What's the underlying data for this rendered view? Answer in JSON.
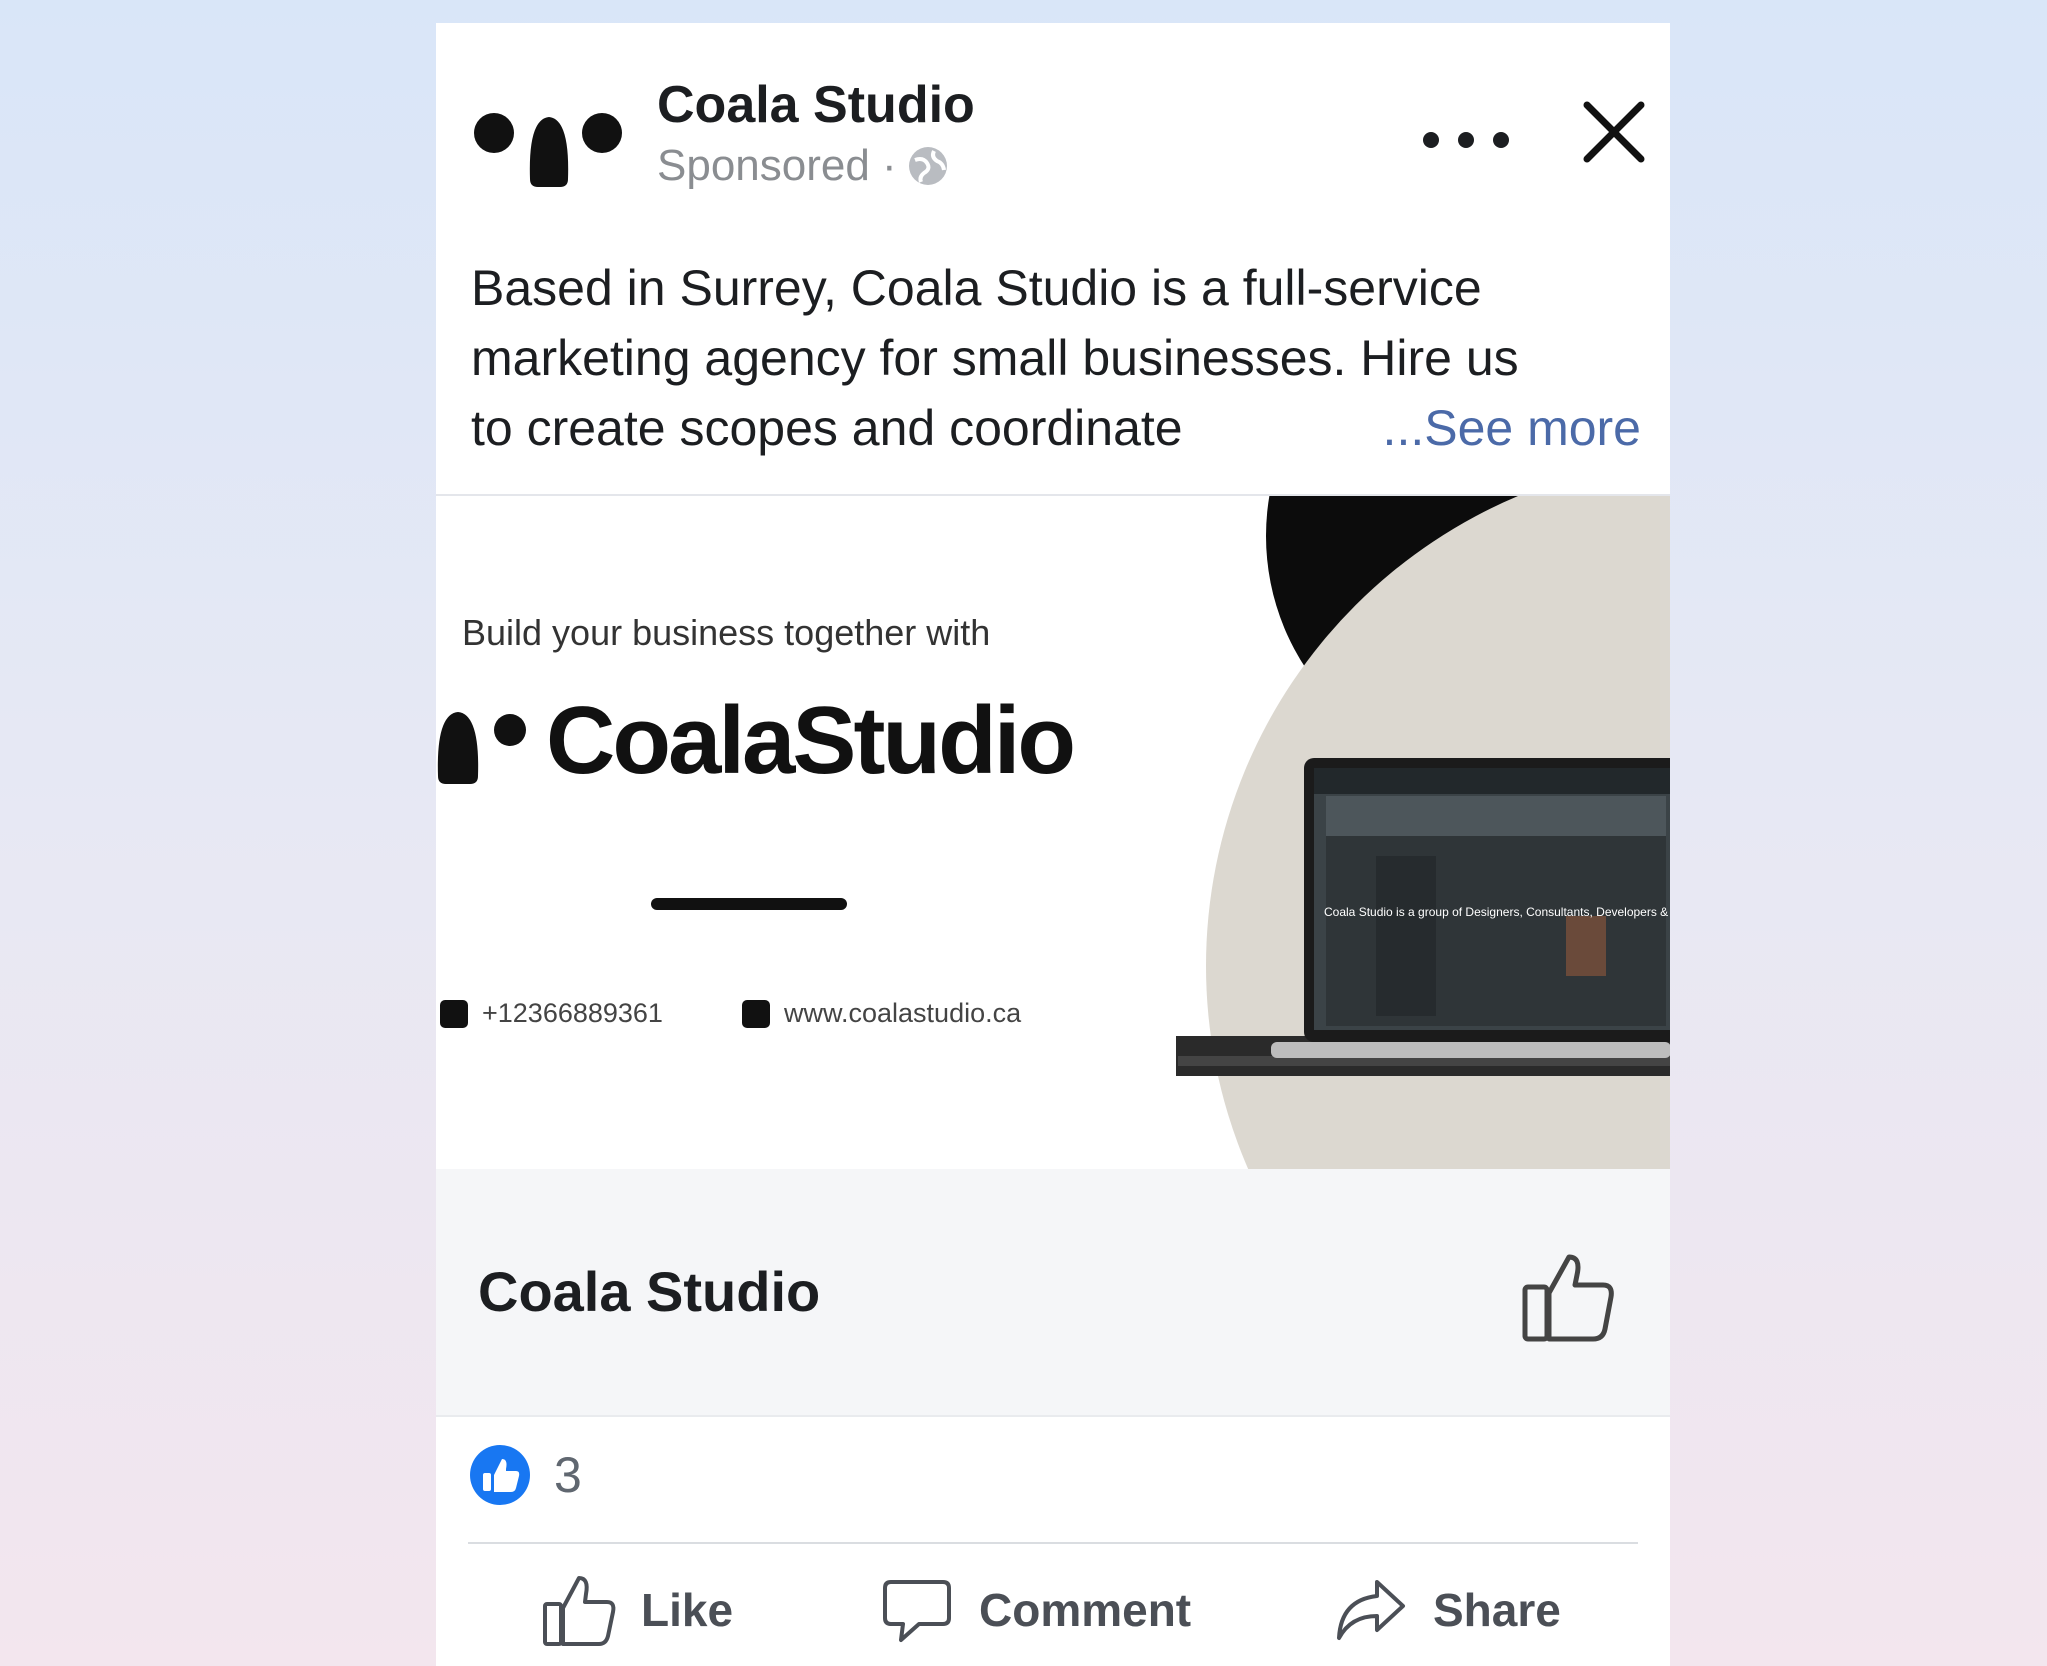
{
  "post": {
    "page_name": "Coala Studio",
    "sponsored_label": "Sponsored ·",
    "text_lines": [
      "Based in Surrey, Coala Studio is a full-service",
      "marketing agency for small businesses. Hire us",
      "to create scopes and coordinate"
    ],
    "see_more": "...See more"
  },
  "ad_image": {
    "tagline": "Build your business together with",
    "brand_name": "CoalaStudio",
    "phone": "+12366889361",
    "website": "www.coalastudio.ca",
    "screen_text": "Coala Studio is a group of Designers, Consultants, Developers & Marketers in Vancouver."
  },
  "link_footer": {
    "title": "Coala Studio"
  },
  "reactions": {
    "count": "3"
  },
  "actions": {
    "like": "Like",
    "comment": "Comment",
    "share": "Share"
  },
  "colors": {
    "link_blue": "#4b6aa8",
    "like_blue": "#1877f2",
    "text": "#1c1e21",
    "muted": "#8a8d91"
  },
  "icons": [
    "coala-logo-icon",
    "globe-icon",
    "more-icon",
    "close-icon",
    "thumbs-up-icon",
    "comment-icon",
    "share-icon",
    "phone-icon",
    "link-icon"
  ]
}
